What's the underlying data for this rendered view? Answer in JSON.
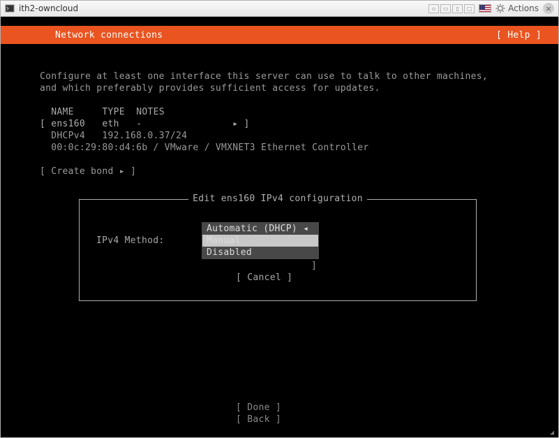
{
  "titlebar": {
    "title": "ith2-owncloud",
    "actions_label": "Actions"
  },
  "header": {
    "title": "Network connections",
    "help_label": "[ Help ]"
  },
  "intro": {
    "line1": "Configure at least one interface this server can use to talk to other machines,",
    "line2": "and which preferably provides sufficient access for updates."
  },
  "columns": {
    "name": "NAME",
    "type": "TYPE",
    "notes": "NOTES"
  },
  "iface": {
    "row": "[ ens160   eth   -                ▸ ]",
    "dhcp": "  DHCPv4   192.168.0.37/24",
    "mac": "  00:0c:29:80:d4:6b / VMware / VMXNET3 Ethernet Controller"
  },
  "create_bond": "[ Create bond ▸ ]",
  "dialog": {
    "title": "Edit ens160 IPv4 configuration",
    "method_label": "IPv4 Method:",
    "options": {
      "auto": "Automatic (DHCP) ◂",
      "manual": "Manual",
      "disabled": "Disabled"
    },
    "cancel": "[ Cancel      ]"
  },
  "footer": {
    "done": "[ Done       ]",
    "back": "[ Back       ]"
  }
}
